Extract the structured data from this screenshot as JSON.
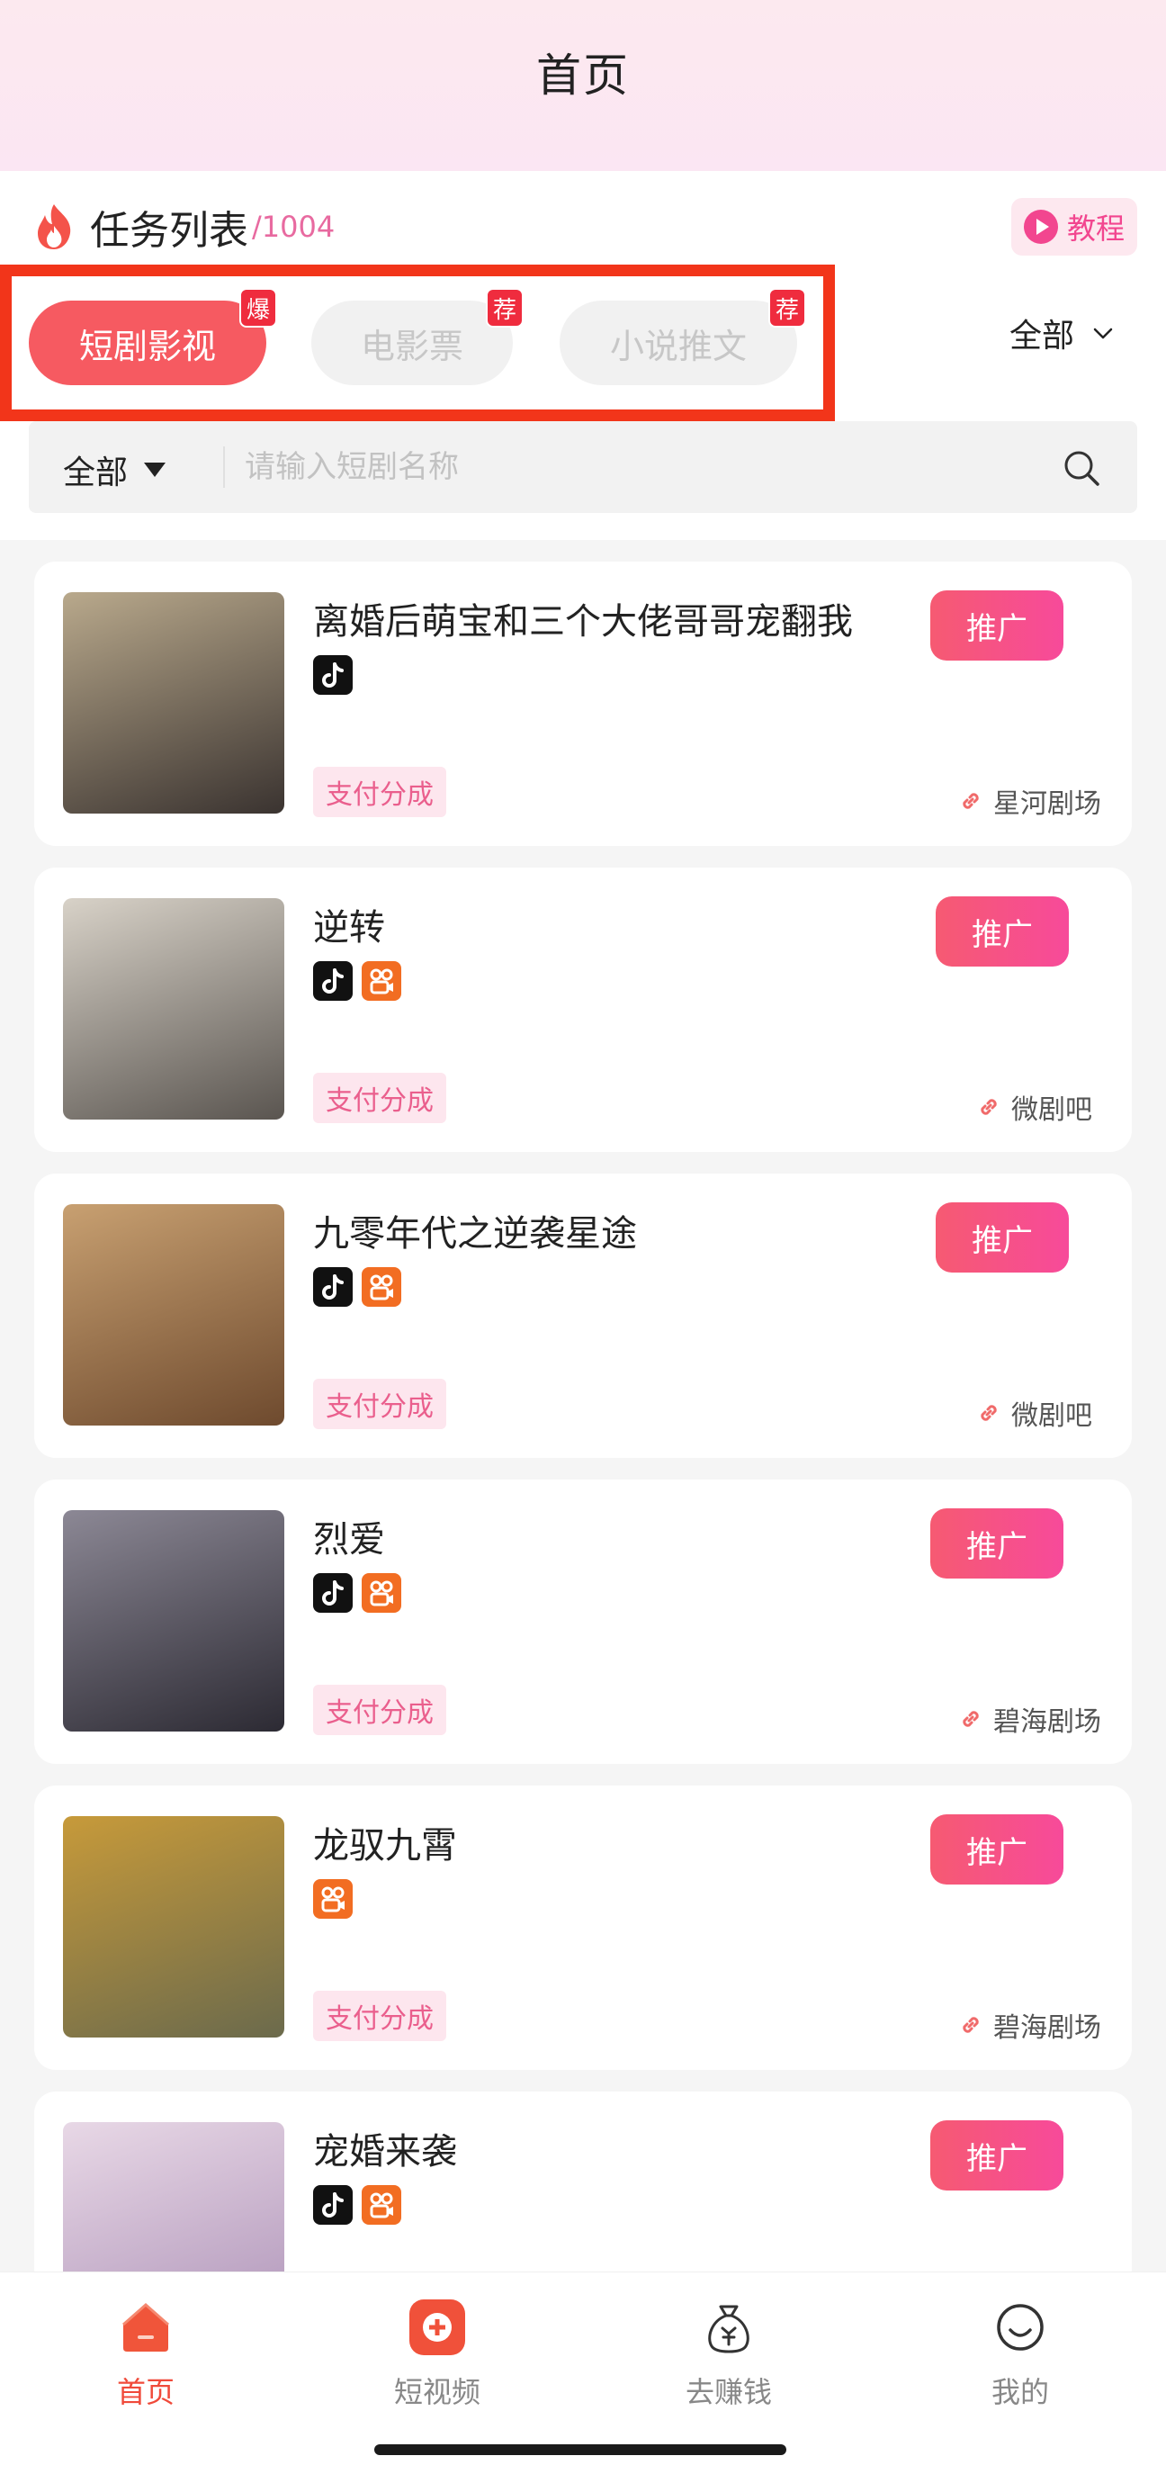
{
  "header": {
    "title": "首页"
  },
  "task_list": {
    "title": "任务列表",
    "count": "/1004",
    "tutorial_label": "教程"
  },
  "tabs": [
    {
      "label": "短剧影视",
      "badge": "爆",
      "active": true
    },
    {
      "label": "电影票",
      "badge": "荐",
      "active": false
    },
    {
      "label": "小说推文",
      "badge": "荐",
      "active": false
    }
  ],
  "category_filter": {
    "label": "全部"
  },
  "search": {
    "filter_label": "全部",
    "placeholder": "请输入短剧名称"
  },
  "cards": [
    {
      "title": "离婚后萌宝和三个大佬哥哥宠翻我",
      "platforms": [
        "douyin-icon"
      ],
      "tag": "支付分成",
      "promote": "推广",
      "source": "星河剧场",
      "poster_colors": [
        "#3a3330",
        "#b9a98c"
      ]
    },
    {
      "title": "逆转",
      "platforms": [
        "douyin-icon",
        "kuaishou-icon"
      ],
      "tag": "支付分成",
      "promote": "推广",
      "source": "微剧吧",
      "poster_colors": [
        "#5a5550",
        "#d8d2c8"
      ]
    },
    {
      "title": "九零年代之逆袭星途",
      "platforms": [
        "douyin-icon",
        "kuaishou-icon"
      ],
      "tag": "支付分成",
      "promote": "推广",
      "source": "微剧吧",
      "poster_colors": [
        "#6e4a2e",
        "#c8a071"
      ]
    },
    {
      "title": "烈爱",
      "platforms": [
        "douyin-icon",
        "kuaishou-icon"
      ],
      "tag": "支付分成",
      "promote": "推广",
      "source": "碧海剧场",
      "poster_colors": [
        "#2c2a33",
        "#8c8895"
      ]
    },
    {
      "title": "龙驭九霄",
      "platforms": [
        "kuaishou-icon"
      ],
      "tag": "支付分成",
      "promote": "推广",
      "source": "碧海剧场",
      "poster_colors": [
        "#6b6a4c",
        "#c79a3a"
      ]
    },
    {
      "title": "宠婚来袭",
      "platforms": [
        "douyin-icon",
        "kuaishou-icon"
      ],
      "tag": "",
      "promote": "推广",
      "source": "",
      "poster_colors": [
        "#b89fc0",
        "#e8d8e6"
      ]
    }
  ],
  "bottom_nav": [
    {
      "label": "首页",
      "icon": "home-icon",
      "active": true
    },
    {
      "label": "短视频",
      "icon": "plus-icon",
      "active": false
    },
    {
      "label": "去赚钱",
      "icon": "money-bag-icon",
      "active": false
    },
    {
      "label": "我的",
      "icon": "smile-icon",
      "active": false
    }
  ],
  "colors": {
    "accent": "#f65a61",
    "pink": "#f2468f",
    "highlight": "#f2351a"
  }
}
